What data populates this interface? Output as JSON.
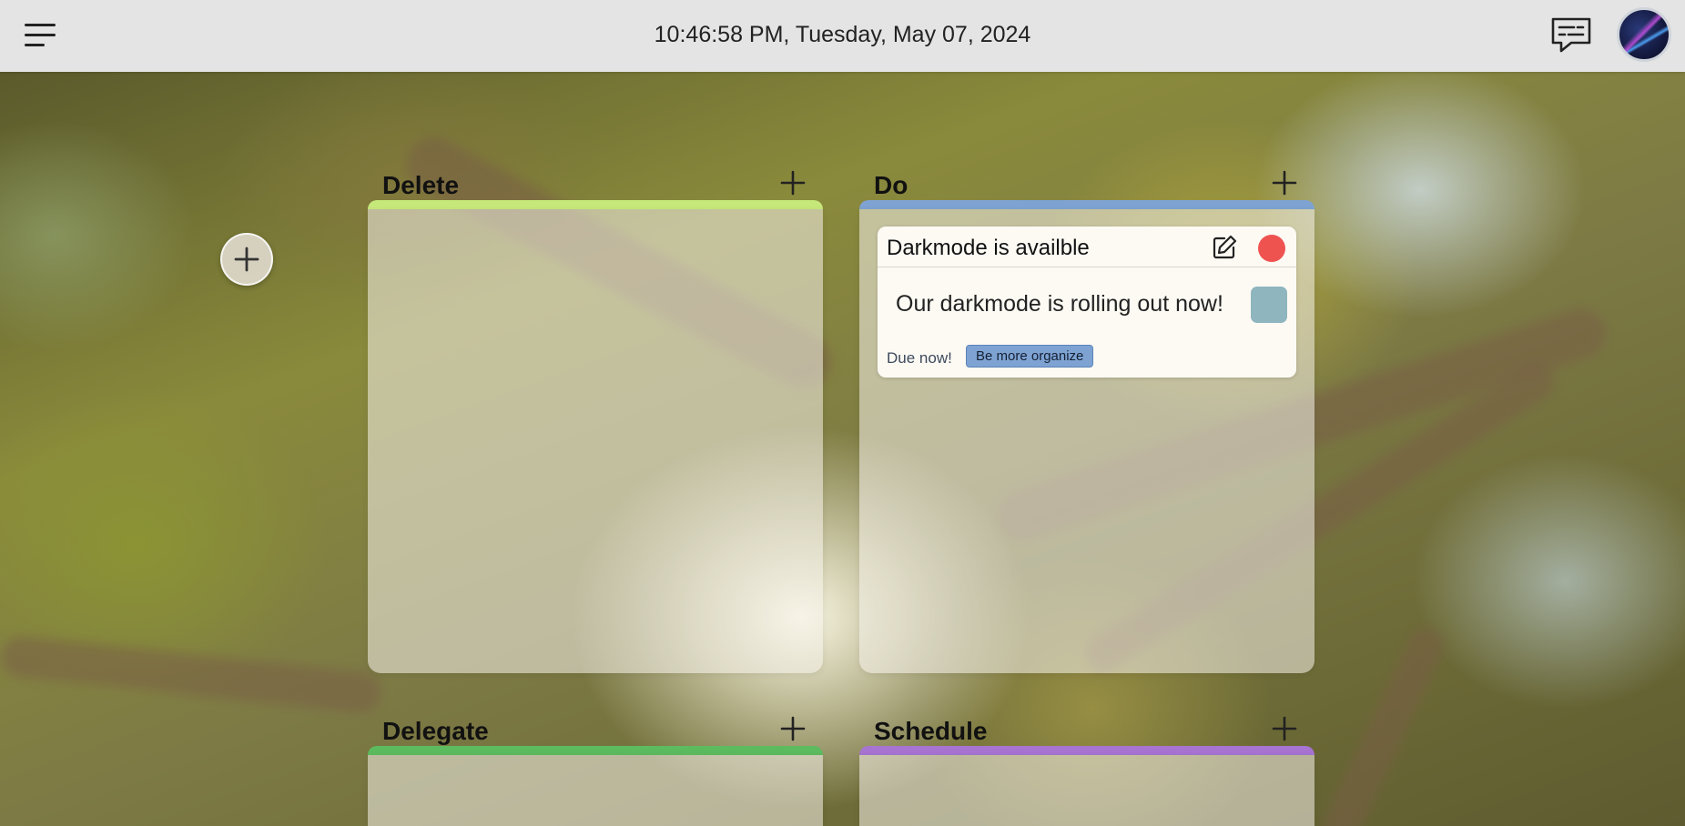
{
  "header": {
    "datetime": "10:46:58 PM, Tuesday, May 07, 2024",
    "menu_icon": "hamburger-menu-icon",
    "chat_icon": "chat-bubble-icon",
    "avatar_icon": "user-avatar"
  },
  "side": {
    "add_icon": "plus-icon"
  },
  "quadrants": [
    {
      "title": "Delete",
      "color": "#c6e87a",
      "add_icon": "plus-icon"
    },
    {
      "title": "Do",
      "color": "#7ea3d3",
      "add_icon": "plus-icon"
    },
    {
      "title": "Delegate",
      "color": "#5cbb5f",
      "add_icon": "plus-icon"
    },
    {
      "title": "Schedule",
      "color": "#a774d1",
      "add_icon": "plus-icon"
    }
  ],
  "tasks": [
    {
      "quadrant": "Do",
      "title": "Darkmode is availble",
      "description": "Our darkmode is rolling out now!",
      "due": "Due now!",
      "tag": "Be more organize",
      "tag_color": "#7ea3d3",
      "swatch_color": "#8fb5bf",
      "delete_color": "#ef5350",
      "edit_icon": "edit-pencil-icon"
    }
  ]
}
